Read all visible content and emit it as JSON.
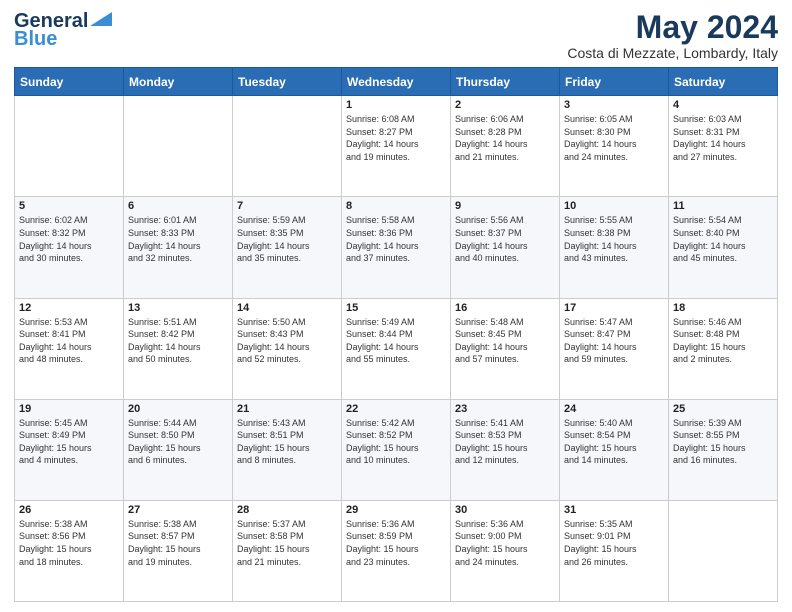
{
  "logo": {
    "line1": "General",
    "line2": "Blue"
  },
  "title": "May 2024",
  "subtitle": "Costa di Mezzate, Lombardy, Italy",
  "days_header": [
    "Sunday",
    "Monday",
    "Tuesday",
    "Wednesday",
    "Thursday",
    "Friday",
    "Saturday"
  ],
  "weeks": [
    [
      {
        "day": "",
        "info": ""
      },
      {
        "day": "",
        "info": ""
      },
      {
        "day": "",
        "info": ""
      },
      {
        "day": "1",
        "info": "Sunrise: 6:08 AM\nSunset: 8:27 PM\nDaylight: 14 hours\nand 19 minutes."
      },
      {
        "day": "2",
        "info": "Sunrise: 6:06 AM\nSunset: 8:28 PM\nDaylight: 14 hours\nand 21 minutes."
      },
      {
        "day": "3",
        "info": "Sunrise: 6:05 AM\nSunset: 8:30 PM\nDaylight: 14 hours\nand 24 minutes."
      },
      {
        "day": "4",
        "info": "Sunrise: 6:03 AM\nSunset: 8:31 PM\nDaylight: 14 hours\nand 27 minutes."
      }
    ],
    [
      {
        "day": "5",
        "info": "Sunrise: 6:02 AM\nSunset: 8:32 PM\nDaylight: 14 hours\nand 30 minutes."
      },
      {
        "day": "6",
        "info": "Sunrise: 6:01 AM\nSunset: 8:33 PM\nDaylight: 14 hours\nand 32 minutes."
      },
      {
        "day": "7",
        "info": "Sunrise: 5:59 AM\nSunset: 8:35 PM\nDaylight: 14 hours\nand 35 minutes."
      },
      {
        "day": "8",
        "info": "Sunrise: 5:58 AM\nSunset: 8:36 PM\nDaylight: 14 hours\nand 37 minutes."
      },
      {
        "day": "9",
        "info": "Sunrise: 5:56 AM\nSunset: 8:37 PM\nDaylight: 14 hours\nand 40 minutes."
      },
      {
        "day": "10",
        "info": "Sunrise: 5:55 AM\nSunset: 8:38 PM\nDaylight: 14 hours\nand 43 minutes."
      },
      {
        "day": "11",
        "info": "Sunrise: 5:54 AM\nSunset: 8:40 PM\nDaylight: 14 hours\nand 45 minutes."
      }
    ],
    [
      {
        "day": "12",
        "info": "Sunrise: 5:53 AM\nSunset: 8:41 PM\nDaylight: 14 hours\nand 48 minutes."
      },
      {
        "day": "13",
        "info": "Sunrise: 5:51 AM\nSunset: 8:42 PM\nDaylight: 14 hours\nand 50 minutes."
      },
      {
        "day": "14",
        "info": "Sunrise: 5:50 AM\nSunset: 8:43 PM\nDaylight: 14 hours\nand 52 minutes."
      },
      {
        "day": "15",
        "info": "Sunrise: 5:49 AM\nSunset: 8:44 PM\nDaylight: 14 hours\nand 55 minutes."
      },
      {
        "day": "16",
        "info": "Sunrise: 5:48 AM\nSunset: 8:45 PM\nDaylight: 14 hours\nand 57 minutes."
      },
      {
        "day": "17",
        "info": "Sunrise: 5:47 AM\nSunset: 8:47 PM\nDaylight: 14 hours\nand 59 minutes."
      },
      {
        "day": "18",
        "info": "Sunrise: 5:46 AM\nSunset: 8:48 PM\nDaylight: 15 hours\nand 2 minutes."
      }
    ],
    [
      {
        "day": "19",
        "info": "Sunrise: 5:45 AM\nSunset: 8:49 PM\nDaylight: 15 hours\nand 4 minutes."
      },
      {
        "day": "20",
        "info": "Sunrise: 5:44 AM\nSunset: 8:50 PM\nDaylight: 15 hours\nand 6 minutes."
      },
      {
        "day": "21",
        "info": "Sunrise: 5:43 AM\nSunset: 8:51 PM\nDaylight: 15 hours\nand 8 minutes."
      },
      {
        "day": "22",
        "info": "Sunrise: 5:42 AM\nSunset: 8:52 PM\nDaylight: 15 hours\nand 10 minutes."
      },
      {
        "day": "23",
        "info": "Sunrise: 5:41 AM\nSunset: 8:53 PM\nDaylight: 15 hours\nand 12 minutes."
      },
      {
        "day": "24",
        "info": "Sunrise: 5:40 AM\nSunset: 8:54 PM\nDaylight: 15 hours\nand 14 minutes."
      },
      {
        "day": "25",
        "info": "Sunrise: 5:39 AM\nSunset: 8:55 PM\nDaylight: 15 hours\nand 16 minutes."
      }
    ],
    [
      {
        "day": "26",
        "info": "Sunrise: 5:38 AM\nSunset: 8:56 PM\nDaylight: 15 hours\nand 18 minutes."
      },
      {
        "day": "27",
        "info": "Sunrise: 5:38 AM\nSunset: 8:57 PM\nDaylight: 15 hours\nand 19 minutes."
      },
      {
        "day": "28",
        "info": "Sunrise: 5:37 AM\nSunset: 8:58 PM\nDaylight: 15 hours\nand 21 minutes."
      },
      {
        "day": "29",
        "info": "Sunrise: 5:36 AM\nSunset: 8:59 PM\nDaylight: 15 hours\nand 23 minutes."
      },
      {
        "day": "30",
        "info": "Sunrise: 5:36 AM\nSunset: 9:00 PM\nDaylight: 15 hours\nand 24 minutes."
      },
      {
        "day": "31",
        "info": "Sunrise: 5:35 AM\nSunset: 9:01 PM\nDaylight: 15 hours\nand 26 minutes."
      },
      {
        "day": "",
        "info": ""
      }
    ]
  ]
}
